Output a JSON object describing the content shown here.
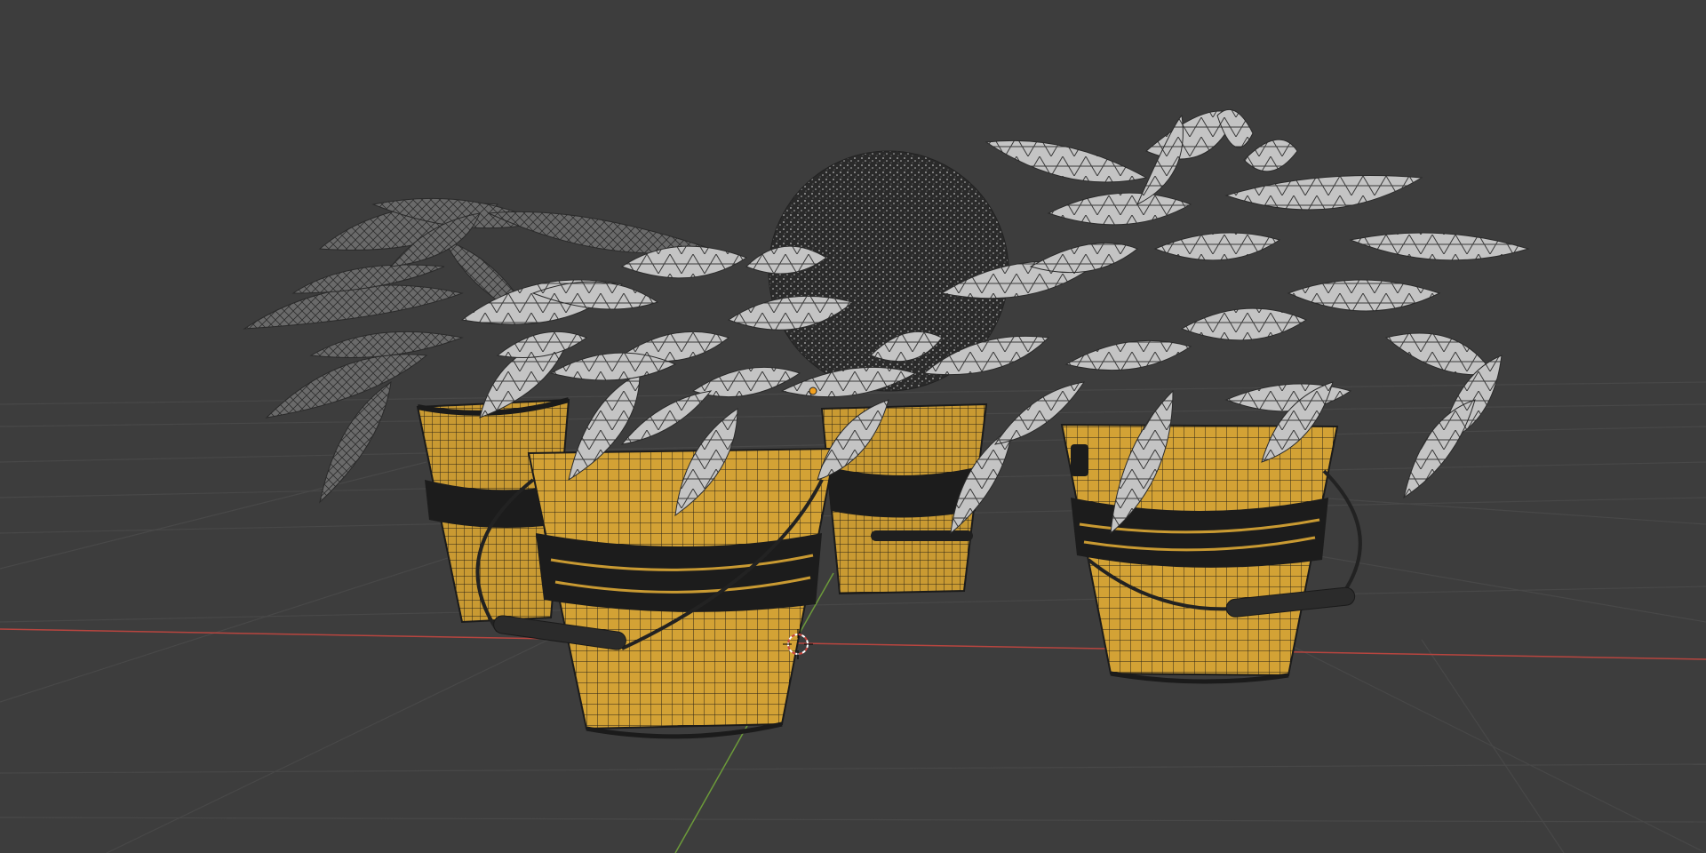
{
  "viewport": {
    "background_color": "#3d3d3d",
    "grid_color": "#4a4a4a",
    "x_axis_color": "#b8453f",
    "y_axis_color": "#6c9a3a",
    "cursor_color": "#ffffff",
    "cursor_accent": "#c8453f",
    "origin_dot_color": "#f0a020"
  },
  "scene": {
    "pot_color": "#d3a235",
    "pot_band_color": "#1c1c1c",
    "wire_color": "#2a2a2a",
    "leaf_light": "#c9c9c9",
    "leaf_dark": "#6e6e6e",
    "icons": [
      "3d-cursor-icon",
      "origin-icon"
    ]
  }
}
